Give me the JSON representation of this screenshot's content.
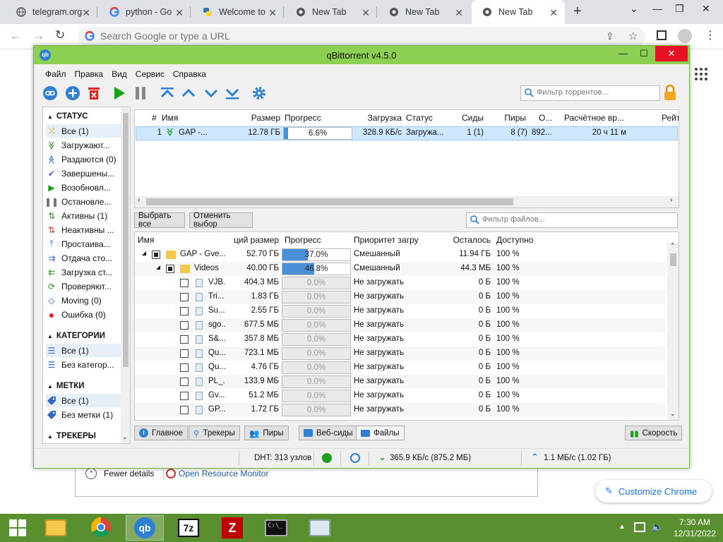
{
  "browser": {
    "tabs": [
      {
        "label": "telegram.org",
        "icon": "globe-icon"
      },
      {
        "label": "python - Go",
        "icon": "google-icon"
      },
      {
        "label": "Welcome to",
        "icon": "python-icon"
      },
      {
        "label": "New Tab",
        "icon": "chrome-icon"
      },
      {
        "label": "New Tab",
        "icon": "chrome-icon"
      },
      {
        "label": "New Tab",
        "icon": "chrome-icon"
      }
    ],
    "new_tab": "+",
    "omnibox_placeholder": "Search Google or type a URL",
    "customize_label": "Customize Chrome",
    "colors": {
      "tabbar": "#dee1e6",
      "accent": "#1a73e8"
    }
  },
  "background_window": {
    "fewer_details": "Fewer details",
    "open_monitor": "Open Resource Monitor"
  },
  "qbittorrent": {
    "title": "qBittorrent v4.5.0",
    "menu": [
      "Файл",
      "Правка",
      "Вид",
      "Сервис",
      "Справка"
    ],
    "torrent_filter_placeholder": "Фильтр торрентов...",
    "files_filter_placeholder": "Фильтр файлов...",
    "sidebar": {
      "status_header": "СТАТУС",
      "status_items": [
        {
          "label": "Все (1)",
          "icon": "shuffle-icon",
          "color": "#c8a000"
        },
        {
          "label": "Загружают...",
          "icon": "download-chevron-icon",
          "color": "#2e8b20"
        },
        {
          "label": "Раздаются (0)",
          "icon": "upload-chevron-icon",
          "color": "#2f66c8"
        },
        {
          "label": "Завершены...",
          "icon": "checkmark-icon",
          "color": "#7a45c8"
        },
        {
          "label": "Возобновл...",
          "icon": "play-icon",
          "color": "#1aa01a"
        },
        {
          "label": "Остановле...",
          "icon": "pause-icon",
          "color": "#777777"
        },
        {
          "label": "Активны (1)",
          "icon": "active-arrows-icon",
          "color": "#2e8b20"
        },
        {
          "label": "Неактивны ...",
          "icon": "inactive-arrows-icon",
          "color": "#d03020"
        },
        {
          "label": "Простаива...",
          "icon": "stalled-icon",
          "color": "#2f66c8"
        },
        {
          "label": "Отдача сто...",
          "icon": "stalled-upload-icon",
          "color": "#2f66c8"
        },
        {
          "label": "Загрузка ст...",
          "icon": "stalled-download-icon",
          "color": "#2e8b20"
        },
        {
          "label": "Проверяют...",
          "icon": "refresh-icon",
          "color": "#1aa01a"
        },
        {
          "label": "Moving (0)",
          "icon": "moving-icon",
          "color": "#2f66c8"
        },
        {
          "label": "Ошибка (0)",
          "icon": "error-icon",
          "color": "#e02020"
        }
      ],
      "categories_header": "КАТЕГОРИИ",
      "category_items": [
        "Все (1)",
        "Без категор..."
      ],
      "tags_header": "МЕТКИ",
      "tag_items": [
        "Все (1)",
        "Без метки (1)"
      ],
      "trackers_header": "ТРЕКЕРЫ"
    },
    "torrent_table": {
      "columns": [
        "#",
        "Имя",
        "Размер",
        "Прогресс",
        "Загрузка",
        "Статус",
        "Сиды",
        "Пиры",
        "О...",
        "Расчётное вр...",
        "Рейт"
      ],
      "rows": [
        {
          "num": "1",
          "name": "GAP -...",
          "size": "12.78 ГБ",
          "progress": "6.6%",
          "progress_value": 0.066,
          "download": "328.9 КБ/с",
          "status": "Загружа...",
          "seeds": "1 (1)",
          "peers": "8 (7)",
          "o": "892...",
          "eta": "20 ч 11 м"
        }
      ]
    },
    "buttons": {
      "select_all": "Выбрать все",
      "deselect": "Отменить выбор"
    },
    "files_table": {
      "columns": [
        "Имя",
        "ций размер",
        "Прогресс",
        "Приоритет загру",
        "Осталось",
        "Доступно"
      ],
      "rows": [
        {
          "name": "GAP - Gve...",
          "kind": "folder",
          "level": 0,
          "expanded": true,
          "size": "52.70 ГБ",
          "progress": "37.0%",
          "progress_value": 0.37,
          "priority": "Смешанный",
          "remaining": "11.94 ГБ",
          "available": "100 %"
        },
        {
          "name": "Videos",
          "kind": "folder",
          "level": 1,
          "expanded": true,
          "size": "40.00 ГБ",
          "progress": "46.8%",
          "progress_value": 0.468,
          "priority": "Смешанный",
          "remaining": "44.3 МБ",
          "available": "100 %"
        },
        {
          "name": "VJB...",
          "kind": "file",
          "level": 2,
          "size": "404.3 МБ",
          "progress": "0.0%",
          "progress_value": 0,
          "priority": "Не загружать",
          "remaining": "0 Б",
          "available": "100 %"
        },
        {
          "name": "Tri...",
          "kind": "file",
          "level": 2,
          "size": "1.83 ГБ",
          "progress": "0.0%",
          "progress_value": 0,
          "priority": "Не загружать",
          "remaining": "0 Б",
          "available": "100 %"
        },
        {
          "name": "Su...",
          "kind": "file",
          "level": 2,
          "size": "2.55 ГБ",
          "progress": "0.0%",
          "progress_value": 0,
          "priority": "Не загружать",
          "remaining": "0 Б",
          "available": "100 %"
        },
        {
          "name": "sgo...",
          "kind": "file",
          "level": 2,
          "size": "677.5 МБ",
          "progress": "0.0%",
          "progress_value": 0,
          "priority": "Не загружать",
          "remaining": "0 Б",
          "available": "100 %"
        },
        {
          "name": "S&...",
          "kind": "file",
          "level": 2,
          "size": "357.8 МБ",
          "progress": "0.0%",
          "progress_value": 0,
          "priority": "Не загружать",
          "remaining": "0 Б",
          "available": "100 %"
        },
        {
          "name": "Qu...",
          "kind": "file",
          "level": 2,
          "size": "723.1 МБ",
          "progress": "0.0%",
          "progress_value": 0,
          "priority": "Не загружать",
          "remaining": "0 Б",
          "available": "100 %"
        },
        {
          "name": "Qu...",
          "kind": "file",
          "level": 2,
          "size": "4.76 ГБ",
          "progress": "0.0%",
          "progress_value": 0,
          "priority": "Не загружать",
          "remaining": "0 Б",
          "available": "100 %"
        },
        {
          "name": "PL_...",
          "kind": "file",
          "level": 2,
          "size": "133.9 МБ",
          "progress": "0.0%",
          "progress_value": 0,
          "priority": "Не загружать",
          "remaining": "0 Б",
          "available": "100 %"
        },
        {
          "name": "Gv...",
          "kind": "file",
          "level": 2,
          "size": "51.2 МБ",
          "progress": "0.0%",
          "progress_value": 0,
          "priority": "Не загружать",
          "remaining": "0 Б",
          "available": "100 %"
        },
        {
          "name": "GP....",
          "kind": "file",
          "level": 2,
          "size": "1.72 ГБ",
          "progress": "0.0%",
          "progress_value": 0,
          "priority": "Не загружать",
          "remaining": "0 Б",
          "available": "100 %"
        }
      ]
    },
    "bottom_tabs": [
      {
        "label": "Главное",
        "icon": "info-icon"
      },
      {
        "label": "Трекеры",
        "icon": "location-pin-icon"
      },
      {
        "label": "Пиры",
        "icon": "people-icon"
      },
      {
        "label": "Веб-сиды",
        "icon": "server-icon"
      },
      {
        "label": "Файлы",
        "icon": "folder-tab-icon"
      }
    ],
    "speed_tab": "Скорость",
    "statusbar": {
      "dht": "DHT: 313 узлов",
      "download": "365.9 КБ/с (875.2 МБ)",
      "upload": "1.1 МБ/с (1.02 ГБ)"
    },
    "colors": {
      "titlebar": "#8bd052",
      "progress": "#4a90d9",
      "selection": "#cde8ff"
    }
  },
  "taskbar": {
    "time": "7:30 AM",
    "date": "12/31/2022",
    "apps": [
      "file-explorer-icon",
      "chrome-icon",
      "qbittorrent-icon",
      "7zip-icon",
      "filezilla-icon",
      "cmd-icon",
      "taskmgr-icon"
    ],
    "color": "#5a8f2f"
  }
}
